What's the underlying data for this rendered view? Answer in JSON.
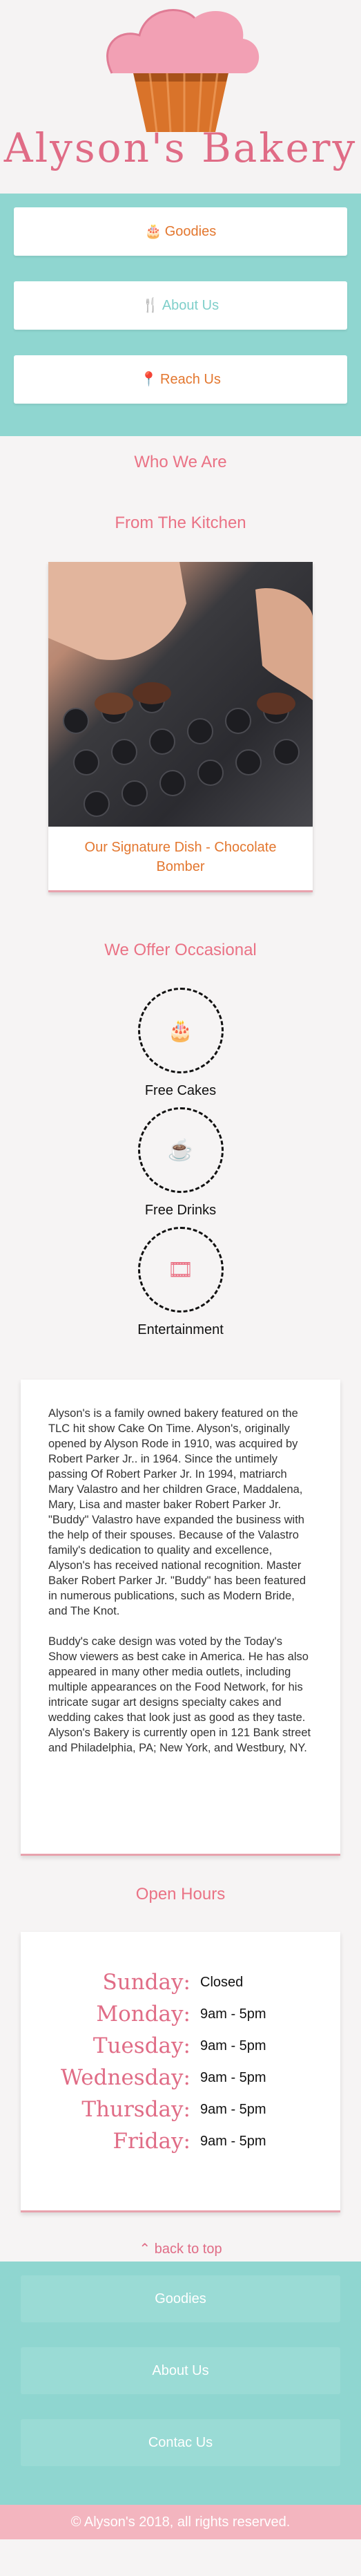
{
  "brand": {
    "name": "Alyson's Bakery",
    "logo_icon": "cupcake-logo"
  },
  "nav": {
    "items": [
      {
        "label": "Goodies",
        "icon": "cake-icon",
        "glyph": "🎂"
      },
      {
        "label": "About Us",
        "icon": "cutlery-icon",
        "glyph": "🍴"
      },
      {
        "label": "Reach Us",
        "icon": "map-marker-icon",
        "glyph": "📍"
      }
    ]
  },
  "who": {
    "title": "Who We Are"
  },
  "kitchen": {
    "title": "From The Kitchen",
    "caption": "Our Signature Dish - Chocolate Bomber"
  },
  "offer": {
    "title": "We Offer Occasional",
    "items": [
      {
        "label": "Free Cakes",
        "icon": "cake-icon",
        "glyph": "🎂"
      },
      {
        "label": "Free Drinks",
        "icon": "coffee-icon",
        "glyph": "☕"
      },
      {
        "label": "Entertainment",
        "icon": "film-icon",
        "glyph": "🎞"
      }
    ]
  },
  "about": {
    "p1": "Alyson's is a family owned bakery featured on the TLC hit show Cake On Time. Alyson's, originally opened by Alyson Rode in 1910, was acquired by Robert Parker Jr.. in 1964. Since the untimely passing Of Robert Parker Jr. In 1994, matriarch Mary Valastro and her children Grace, Maddalena, Mary, Lisa and master baker Robert Parker Jr. \"Buddy\" Valastro have expanded the business with the help of their spouses. Because of the Valastro family's dedication to quality and excellence, Alyson's has received national recognition. Master Baker Robert Parker Jr. \"Buddy\" has been featured in numerous publications, such as Modern Bride, and The Knot.",
    "p2": "Buddy's cake design was voted by the Today's Show viewers as best cake in America. He has also appeared in many other media outlets, including multiple appearances on the Food Network, for his intricate sugar art designs specialty cakes and wedding cakes that look just as good as they taste. Alyson's Bakery is currently open in 121 Bank street and Philadelphia, PA; New York, and Westbury, NY."
  },
  "hours": {
    "title": "Open Hours",
    "rows": [
      {
        "day": "Sunday:",
        "time": "Closed"
      },
      {
        "day": "Monday:",
        "time": "9am - 5pm"
      },
      {
        "day": "Tuesday:",
        "time": "9am - 5pm"
      },
      {
        "day": "Wednesday:",
        "time": "9am - 5pm"
      },
      {
        "day": "Thursday:",
        "time": "9am - 5pm"
      },
      {
        "day": "Friday:",
        "time": "9am - 5pm"
      }
    ]
  },
  "back_to_top": {
    "label": "back to top",
    "icon": "chevron-up-icon"
  },
  "footer": {
    "items": [
      "Goodies",
      "About Us",
      "Contac Us"
    ],
    "copyright": "© Alyson's 2018, all rights reserved."
  }
}
